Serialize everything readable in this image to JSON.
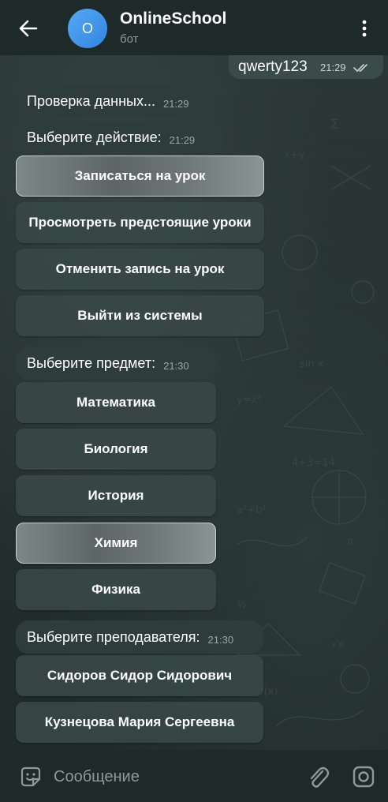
{
  "header": {
    "title": "OnlineSchool",
    "subtitle": "бот",
    "avatar_letter": "O",
    "icons": {
      "back": "arrow-left-icon",
      "menu": "more-vertical-icon"
    }
  },
  "messages": {
    "outgoing": {
      "text": "qwerty123",
      "time": "21:29",
      "status": "read-double-check-icon"
    },
    "checking": {
      "text": "Проверка данных...",
      "time": "21:29"
    },
    "choose_action": {
      "text": "Выберите действие:",
      "time": "21:29"
    },
    "choose_subject": {
      "text": "Выберите предмет:",
      "time": "21:30"
    },
    "choose_teacher": {
      "text": "Выберите преподавателя:",
      "time": "21:30"
    }
  },
  "action_buttons": [
    "Записаться на урок",
    "Просмотреть предстоящие уроки",
    "Отменить запись на урок",
    "Выйти из системы"
  ],
  "subject_buttons": [
    "Математика",
    "Биология",
    "История",
    "Химия",
    "Физика"
  ],
  "teacher_buttons": [
    "Сидоров Сидор Сидорович",
    "Кузнецова Мария Сергеевна"
  ],
  "input": {
    "placeholder": "Сообщение",
    "value": "",
    "icons": {
      "sticker": "sticker-icon",
      "attach": "paperclip-icon",
      "camera": "camera-icon"
    }
  },
  "colors": {
    "header_bg": "#1e2a28",
    "bubble_in": "#2e3c3a",
    "bubble_out": "#3b4b49",
    "avatar": "#3d95ec"
  }
}
